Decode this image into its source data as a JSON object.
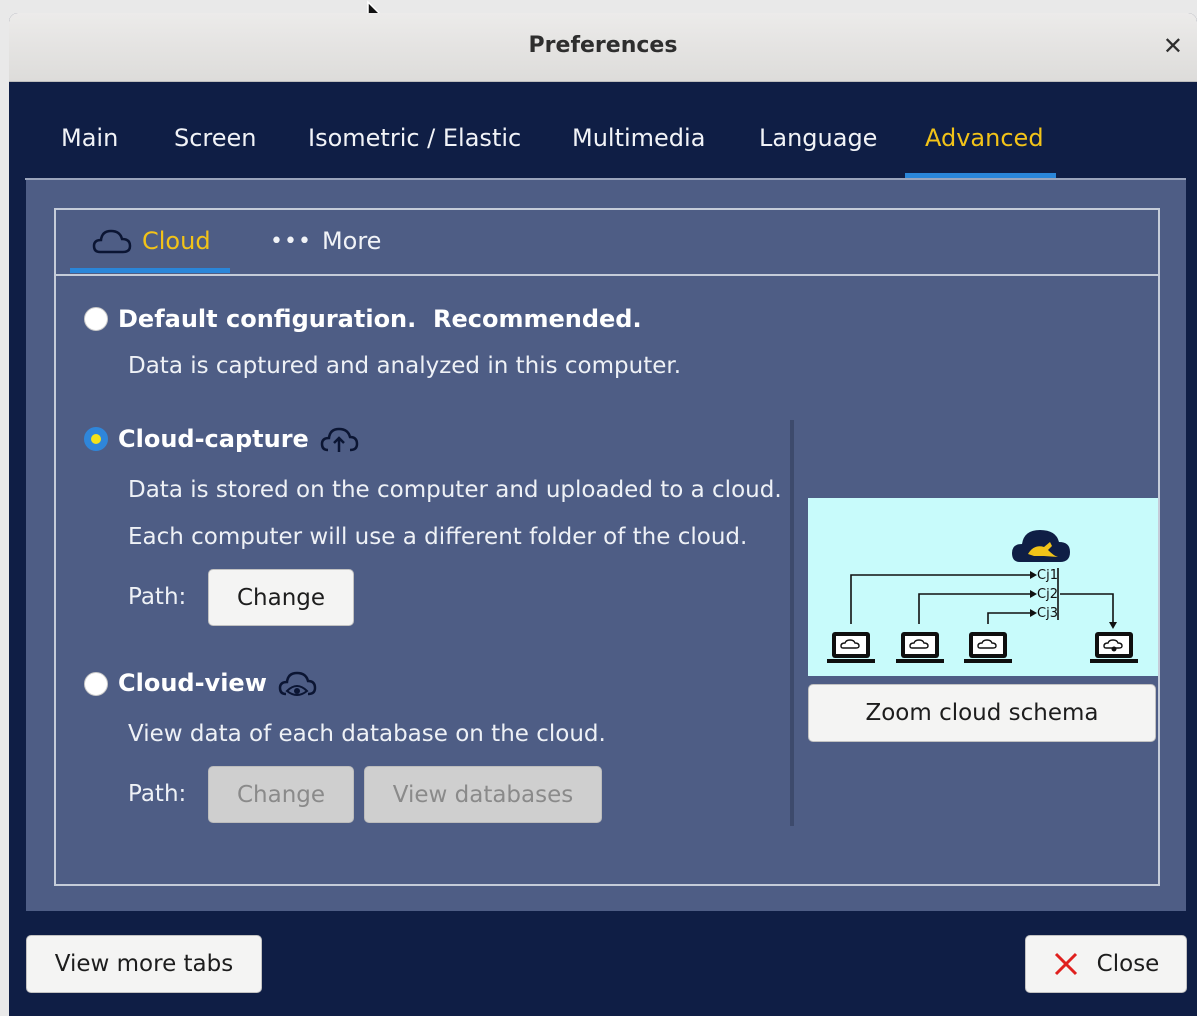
{
  "window": {
    "title": "Preferences"
  },
  "tabs": [
    {
      "label": "Main"
    },
    {
      "label": "Screen"
    },
    {
      "label": "Isometric / Elastic"
    },
    {
      "label": "Multimedia"
    },
    {
      "label": "Language"
    },
    {
      "label": "Advanced",
      "active": true
    }
  ],
  "subtabs": {
    "cloud": {
      "label": "Cloud",
      "icon": "cloud-outline-icon",
      "active": true
    },
    "more": {
      "label": "More",
      "icon": "ellipsis-icon"
    }
  },
  "options": {
    "default": {
      "title": "Default configuration.  Recommended.",
      "description": "Data is captured and analyzed in this computer.",
      "selected": false
    },
    "cloud_capture": {
      "title": "Cloud-capture",
      "icon": "cloud-upload-icon",
      "description1": "Data is stored on the computer and uploaded to a cloud.",
      "description2": "Each computer will use a different folder of the cloud.",
      "path_label": "Path:",
      "change_label": "Change",
      "selected": true
    },
    "cloud_view": {
      "title": "Cloud-view",
      "icon": "cloud-eye-icon",
      "description": "View data of each database on the cloud.",
      "path_label": "Path:",
      "change_label": "Change",
      "view_databases_label": "View databases",
      "selected": false,
      "buttons_enabled": false
    }
  },
  "schema": {
    "labels": [
      "Cj1",
      "Cj2",
      "Cj3"
    ],
    "zoom_label": "Zoom cloud schema",
    "logo_icon": "kangaroo-cloud-icon"
  },
  "footer": {
    "view_more_tabs": "View more tabs",
    "close": "Close",
    "close_icon": "red-x-icon"
  },
  "colors": {
    "accent": "#f2c318",
    "tab_underline": "#2a86d9",
    "window_bg": "#0f1e45",
    "panel_bg": "#4e5d85",
    "schema_bg": "#c8fbfb"
  }
}
